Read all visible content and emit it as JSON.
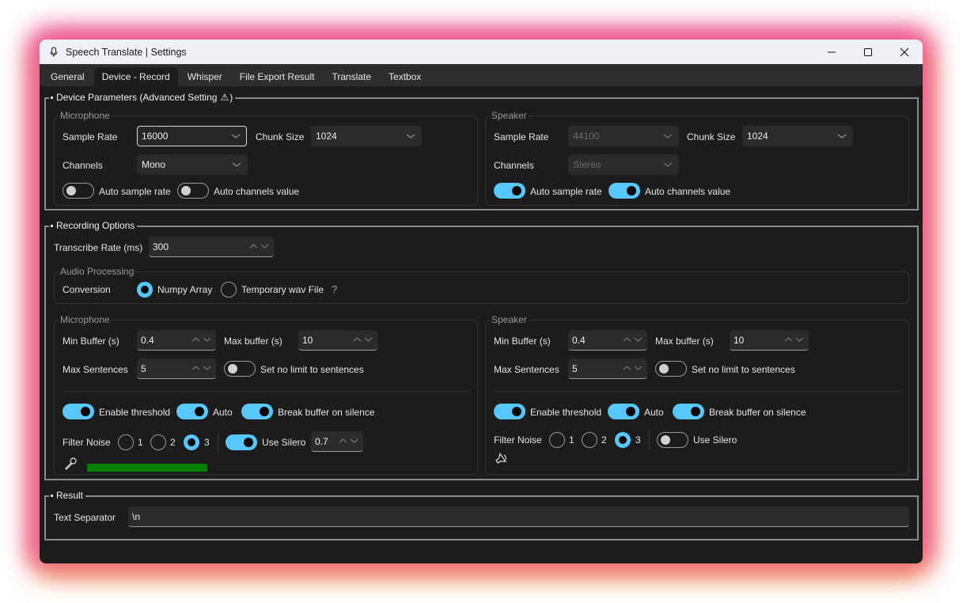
{
  "window": {
    "title": "Speech Translate | Settings",
    "app_icon": "microphone-icon",
    "controls": [
      "minimize-icon",
      "maximize-icon",
      "close-icon"
    ]
  },
  "tabs": [
    {
      "label": "General",
      "active": false
    },
    {
      "label": "Device - Record",
      "active": true
    },
    {
      "label": "Whisper",
      "active": false
    },
    {
      "label": "File Export Result",
      "active": false
    },
    {
      "label": "Translate",
      "active": false
    },
    {
      "label": "Textbox",
      "active": false
    }
  ],
  "device_parameters": {
    "title": "Device Parameters (Advanced Setting",
    "warning_icon": "⚠",
    "title_close": ")",
    "microphone": {
      "group_title": "Microphone",
      "sample_rate_label": "Sample Rate",
      "sample_rate_value": "16000",
      "chunk_size_label": "Chunk Size",
      "chunk_size_value": "1024",
      "channels_label": "Channels",
      "channels_value": "Mono",
      "auto_sample_rate_label": "Auto sample rate",
      "auto_sample_rate_on": false,
      "auto_channels_label": "Auto channels value",
      "auto_channels_on": false
    },
    "speaker": {
      "group_title": "Speaker",
      "sample_rate_label": "Sample Rate",
      "sample_rate_value": "44100",
      "chunk_size_label": "Chunk Size",
      "chunk_size_value": "1024",
      "channels_label": "Channels",
      "channels_value": "Stereo",
      "auto_sample_rate_label": "Auto sample rate",
      "auto_sample_rate_on": true,
      "auto_channels_label": "Auto channels value",
      "auto_channels_on": true
    }
  },
  "recording_options": {
    "title": "Recording Options",
    "transcribe_rate_label": "Transcribe Rate (ms)",
    "transcribe_rate_value": "300",
    "audio_processing": {
      "group_title": "Audio Processing",
      "conversion_label": "Conversion",
      "options": [
        {
          "label": "Numpy Array",
          "selected": true
        },
        {
          "label": "Temporary wav File",
          "selected": false
        }
      ],
      "help": "?"
    },
    "microphone": {
      "group_title": "Microphone",
      "min_buffer_label": "Min Buffer (s)",
      "min_buffer_value": "0.4",
      "max_buffer_label": "Max buffer (s)",
      "max_buffer_value": "10",
      "max_sentences_label": "Max Sentences",
      "max_sentences_value": "5",
      "no_limit_label": "Set no limit to sentences",
      "no_limit_on": false,
      "enable_threshold_label": "Enable threshold",
      "enable_threshold_on": true,
      "auto_label": "Auto",
      "auto_on": true,
      "break_buffer_label": "Break buffer on silence",
      "break_buffer_on": true,
      "filter_noise_label": "Filter Noise",
      "filter_noise_options": [
        "1",
        "2",
        "3"
      ],
      "filter_noise_selected": "3",
      "use_silero_label": "Use Silero",
      "use_silero_on": true,
      "silero_value": "0.7",
      "level_icon": "microphone-icon",
      "level_fraction": 1.0,
      "level_color": "#008000"
    },
    "speaker": {
      "group_title": "Speaker",
      "min_buffer_label": "Min Buffer (s)",
      "min_buffer_value": "0.4",
      "max_buffer_label": "Max buffer (s)",
      "max_buffer_value": "10",
      "max_sentences_label": "Max Sentences",
      "max_sentences_value": "5",
      "no_limit_label": "Set no limit to sentences",
      "no_limit_on": false,
      "enable_threshold_label": "Enable threshold",
      "enable_threshold_on": true,
      "auto_label": "Auto",
      "auto_on": true,
      "break_buffer_label": "Break buffer on silence",
      "break_buffer_on": true,
      "filter_noise_label": "Filter Noise",
      "filter_noise_options": [
        "1",
        "2",
        "3"
      ],
      "filter_noise_selected": "3",
      "use_silero_label": "Use Silero",
      "use_silero_on": false,
      "level_icon": "speaker-icon"
    }
  },
  "result": {
    "title": "Result",
    "text_separator_label": "Text Separator",
    "text_separator_value": "\\n"
  },
  "colors": {
    "accent": "#57c8ff",
    "background": "#1c1c1c",
    "tabbar": "#2d2d2d",
    "titlebar": "#eff1f6"
  }
}
